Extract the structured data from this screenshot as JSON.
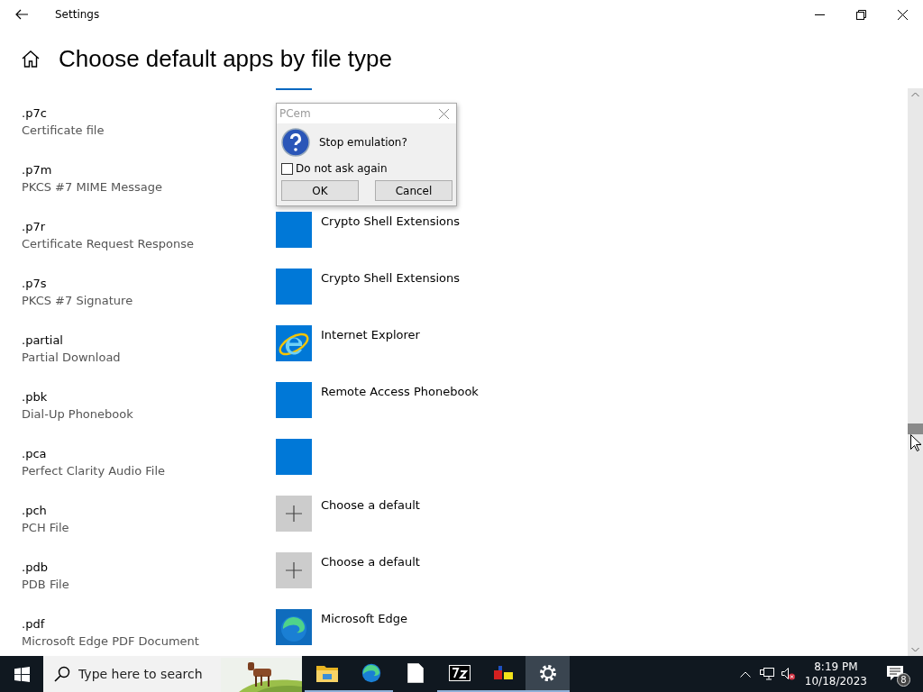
{
  "window": {
    "title": "Settings"
  },
  "page": {
    "heading": "Choose default apps by file type"
  },
  "rows": [
    {
      "extension": ".p7c",
      "description": "Certificate file"
    },
    {
      "extension": ".p7m",
      "description": "PKCS #7 MIME Message"
    },
    {
      "extension": ".p7r",
      "description": "Certificate Request Response",
      "kind": "blank",
      "app": "Crypto Shell Extensions"
    },
    {
      "extension": ".p7s",
      "description": "PKCS #7 Signature",
      "kind": "blank",
      "app": "Crypto Shell Extensions"
    },
    {
      "extension": ".partial",
      "description": "Partial Download",
      "kind": "ie",
      "app": "Internet Explorer"
    },
    {
      "extension": ".pbk",
      "description": "Dial-Up Phonebook",
      "kind": "blank",
      "app": "Remote Access Phonebook"
    },
    {
      "extension": ".pca",
      "description": "Perfect Clarity Audio File",
      "kind": "blank"
    },
    {
      "extension": ".pch",
      "description": "PCH File",
      "kind": "plus",
      "app": "Choose a default"
    },
    {
      "extension": ".pdb",
      "description": "PDB File",
      "kind": "plus",
      "app": "Choose a default"
    },
    {
      "extension": ".pdf",
      "description": "Microsoft Edge PDF Document",
      "kind": "edge",
      "app": "Microsoft Edge"
    }
  ],
  "dialog": {
    "title": "PCem",
    "message": "Stop emulation?",
    "checkbox": {
      "label": "Do not ask again",
      "checked": false
    },
    "buttons": [
      "OK",
      "Cancel"
    ]
  },
  "taskbar": {
    "search": {
      "placeholder": "Type here to search"
    },
    "apps": [
      {
        "kind": "folder",
        "running": true,
        "selected": false
      },
      {
        "kind": "edge",
        "running": true,
        "selected": false
      },
      {
        "kind": "file",
        "running": false,
        "selected": false
      },
      {
        "kind": "archive",
        "running": true,
        "selected": false
      },
      {
        "kind": "blocks",
        "running": true,
        "selected": false
      },
      {
        "kind": "gear",
        "running": true,
        "selected": true
      }
    ],
    "time": "8:19 PM",
    "date": "10/18/2023",
    "notifications": "8"
  }
}
